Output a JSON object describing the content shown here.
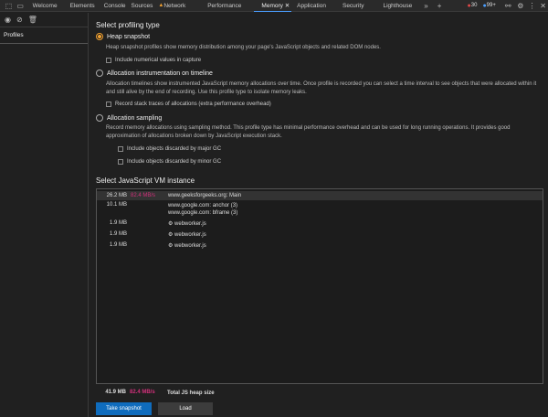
{
  "tabs": [
    "Welcome",
    "Elements",
    "Console",
    "Sources",
    "Network",
    "Performance",
    "Memory",
    "Application",
    "Security",
    "Lighthouse"
  ],
  "badges": {
    "errors": "30",
    "info": "99+"
  },
  "sidebar": {
    "profiles_label": "Profiles"
  },
  "main": {
    "title": "Select profiling type",
    "options": [
      {
        "label": "Heap snapshot",
        "desc": "Heap snapshot profiles show memory distribution among your page's JavaScript objects and related DOM nodes.",
        "checks": [
          "Include numerical values in capture"
        ]
      },
      {
        "label": "Allocation instrumentation on timeline",
        "desc": "Allocation timelines show instrumented JavaScript memory allocations over time. Once profile is recorded you can select a time interval to see objects that were allocated within it and still alive by the end of recording. Use this profile type to isolate memory leaks.",
        "checks": [
          "Record stack traces of allocations (extra performance overhead)"
        ]
      },
      {
        "label": "Allocation sampling",
        "desc": "Record memory allocations using sampling method. This profile type has minimal performance overhead and can be used for long running operations. It provides good approximation of allocations broken down by JavaScript execution stack.",
        "checks": [
          "Include objects discarded by major GC",
          "Include objects discarded by minor GC"
        ]
      }
    ],
    "vm_title": "Select JavaScript VM instance",
    "vms": [
      {
        "size": "26.2 MB",
        "rate": "82.4 MB/s",
        "name": "www.geeksforgeeks.org: Main"
      },
      {
        "size": "10.1 MB",
        "rate": "",
        "name": "www.google.com: anchor (3)",
        "name2": "www.google.com: bframe (3)"
      },
      {
        "size": "1.9 MB",
        "rate": "",
        "name": "⚙ webworker.js"
      },
      {
        "size": "1.9 MB",
        "rate": "",
        "name": "⚙ webworker.js"
      },
      {
        "size": "1.9 MB",
        "rate": "",
        "name": "⚙ webworker.js"
      }
    ],
    "total": {
      "size": "41.9 MB",
      "rate": "82.4 MB/s",
      "label": "Total JS heap size"
    },
    "take_snapshot": "Take snapshot",
    "load": "Load"
  }
}
